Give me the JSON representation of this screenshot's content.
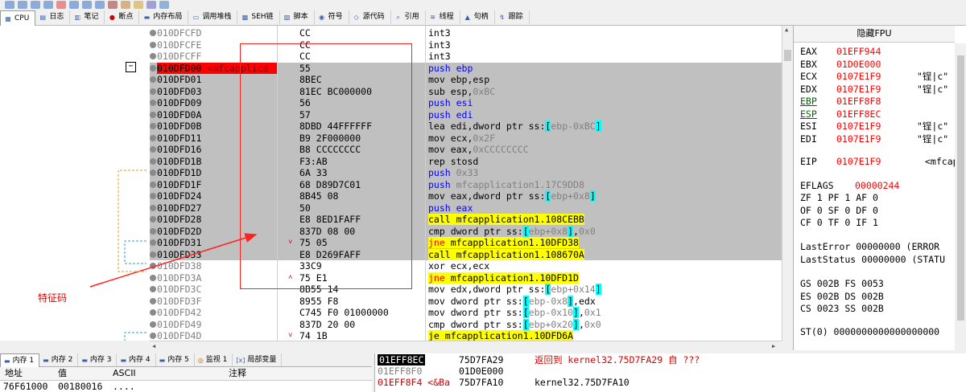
{
  "tabs": [
    {
      "icon": "cpu-icon",
      "label": "CPU"
    },
    {
      "icon": "log-icon",
      "label": "日志"
    },
    {
      "icon": "notes-icon",
      "label": "笔记"
    },
    {
      "icon": "breakpoint-icon",
      "label": "断点"
    },
    {
      "icon": "memory-map-icon",
      "label": "内存布局"
    },
    {
      "icon": "callstack-icon",
      "label": "调用堆栈"
    },
    {
      "icon": "seh-icon",
      "label": "SEH链"
    },
    {
      "icon": "script-icon",
      "label": "脚本"
    },
    {
      "icon": "symbol-icon",
      "label": "符号"
    },
    {
      "icon": "source-icon",
      "label": "源代码"
    },
    {
      "icon": "reference-icon",
      "label": "引用"
    },
    {
      "icon": "thread-icon",
      "label": "线程"
    },
    {
      "icon": "handle-icon",
      "label": "句柄"
    },
    {
      "icon": "trace-icon",
      "label": "跟踪"
    }
  ],
  "disasm": [
    {
      "addr": "010DFCFD",
      "label": "",
      "bytes": "CC",
      "mark": "",
      "hl": false,
      "cur": false,
      "instr": [
        {
          "t": "int3",
          "c": ""
        }
      ]
    },
    {
      "addr": "010DFCFE",
      "label": "",
      "bytes": "CC",
      "mark": "",
      "hl": false,
      "cur": false,
      "instr": [
        {
          "t": "int3",
          "c": ""
        }
      ]
    },
    {
      "addr": "010DFCFF",
      "label": "",
      "bytes": "CC",
      "mark": "",
      "hl": false,
      "cur": false,
      "instr": [
        {
          "t": "int3",
          "c": ""
        }
      ]
    },
    {
      "addr": "010DFD00",
      "label": " <mfcapplica",
      "bytes": "55",
      "mark": "",
      "hl": true,
      "cur": true,
      "instr": [
        {
          "t": "push ebp",
          "c": "k-blue"
        }
      ]
    },
    {
      "addr": "010DFD01",
      "label": "",
      "bytes": "8BEC",
      "mark": "",
      "hl": true,
      "cur": false,
      "instr": [
        {
          "t": "mov ebp,esp",
          "c": ""
        }
      ]
    },
    {
      "addr": "010DFD03",
      "label": "",
      "bytes": "81EC BC000000",
      "mark": "",
      "hl": true,
      "cur": false,
      "instr": [
        {
          "t": "sub esp,",
          "c": ""
        },
        {
          "t": "0xBC",
          "c": "k-gray"
        }
      ]
    },
    {
      "addr": "010DFD09",
      "label": "",
      "bytes": "56",
      "mark": "",
      "hl": true,
      "cur": false,
      "instr": [
        {
          "t": "push esi",
          "c": "k-blue"
        }
      ]
    },
    {
      "addr": "010DFD0A",
      "label": "",
      "bytes": "57",
      "mark": "",
      "hl": true,
      "cur": false,
      "instr": [
        {
          "t": "push edi",
          "c": "k-blue"
        }
      ]
    },
    {
      "addr": "010DFD0B",
      "label": "",
      "bytes": "8DBD 44FFFFFF",
      "mark": "",
      "hl": true,
      "cur": false,
      "instr": [
        {
          "t": "lea edi,dword ptr ss:",
          "c": ""
        },
        {
          "t": "[",
          "c": "cbg"
        },
        {
          "t": "ebp-0xBC",
          "c": "k-gray"
        },
        {
          "t": "]",
          "c": "cbg"
        }
      ]
    },
    {
      "addr": "010DFD11",
      "label": "",
      "bytes": "B9 2F000000",
      "mark": "",
      "hl": true,
      "cur": false,
      "instr": [
        {
          "t": "mov ecx,",
          "c": ""
        },
        {
          "t": "0x2F",
          "c": "k-gray"
        }
      ]
    },
    {
      "addr": "010DFD16",
      "label": "",
      "bytes": "B8 CCCCCCCC",
      "mark": "",
      "hl": true,
      "cur": false,
      "instr": [
        {
          "t": "mov eax,",
          "c": ""
        },
        {
          "t": "0xCCCCCCCC",
          "c": "k-gray"
        }
      ]
    },
    {
      "addr": "010DFD1B",
      "label": "",
      "bytes": "F3:AB",
      "mark": "",
      "hl": true,
      "cur": false,
      "instr": [
        {
          "t": "rep stosd",
          "c": ""
        }
      ]
    },
    {
      "addr": "010DFD1D",
      "label": "",
      "bytes": "6A 33",
      "mark": "",
      "hl": true,
      "cur": false,
      "instr": [
        {
          "t": "push ",
          "c": "k-blue"
        },
        {
          "t": "0x33",
          "c": "k-gray"
        }
      ]
    },
    {
      "addr": "010DFD1F",
      "label": "",
      "bytes": "68 D89D7C01",
      "mark": "",
      "hl": true,
      "cur": false,
      "instr": [
        {
          "t": "push ",
          "c": "k-blue"
        },
        {
          "t": "mfcapplication1.17C9DD8",
          "c": "k-gray"
        }
      ]
    },
    {
      "addr": "010DFD24",
      "label": "",
      "bytes": "8B45 08",
      "mark": "",
      "hl": true,
      "cur": false,
      "instr": [
        {
          "t": "mov eax,dword ptr ss:",
          "c": ""
        },
        {
          "t": "[",
          "c": "cbg"
        },
        {
          "t": "ebp+0x8",
          "c": "k-gray"
        },
        {
          "t": "]",
          "c": "cbg"
        }
      ]
    },
    {
      "addr": "010DFD27",
      "label": "",
      "bytes": "50",
      "mark": "",
      "hl": true,
      "cur": false,
      "instr": [
        {
          "t": "push eax",
          "c": "k-blue"
        }
      ]
    },
    {
      "addr": "010DFD28",
      "label": "",
      "bytes": "E8 8ED1FAFF",
      "mark": "",
      "hl": true,
      "cur": false,
      "instr": [
        {
          "t": "call mfcapplication1.108CEBB",
          "c": "ybg"
        }
      ]
    },
    {
      "addr": "010DFD2D",
      "label": "",
      "bytes": "837D 08 00",
      "mark": "",
      "hl": true,
      "cur": false,
      "instr": [
        {
          "t": "cmp dword ptr ss:",
          "c": ""
        },
        {
          "t": "[",
          "c": "cbg"
        },
        {
          "t": "ebp+0x8",
          "c": "k-gray"
        },
        {
          "t": "]",
          "c": "cbg"
        },
        {
          "t": ",",
          "c": ""
        },
        {
          "t": "0x0",
          "c": "k-gray"
        }
      ]
    },
    {
      "addr": "010DFD31",
      "label": "",
      "bytes": "75 05",
      "mark": "˅",
      "hl": true,
      "cur": false,
      "instr": [
        {
          "t": "jne",
          "c": "ybg k-red"
        },
        {
          "t": " mfcapplication1.10DFD38",
          "c": "ybg"
        }
      ]
    },
    {
      "addr": "010DFD33",
      "label": "",
      "bytes": "E8 D269FAFF",
      "mark": "",
      "hl": true,
      "cur": false,
      "instr": [
        {
          "t": "call mfcapplication1.108670A",
          "c": "ybg"
        }
      ]
    },
    {
      "addr": "010DFD38",
      "label": "",
      "bytes": "33C9",
      "mark": "",
      "hl": false,
      "cur": false,
      "instr": [
        {
          "t": "xor ecx,ecx",
          "c": ""
        }
      ]
    },
    {
      "addr": "010DFD3A",
      "label": "",
      "bytes": "75 E1",
      "mark": "˄",
      "hl": false,
      "cur": false,
      "instr": [
        {
          "t": "jne",
          "c": "ybg k-red"
        },
        {
          "t": " mfcapplication1.10DFD1D",
          "c": "ybg"
        }
      ]
    },
    {
      "addr": "010DFD3C",
      "label": "",
      "bytes": "8B55 14",
      "mark": "",
      "hl": false,
      "cur": false,
      "instr": [
        {
          "t": "mov edx,dword ptr ss:",
          "c": ""
        },
        {
          "t": "[",
          "c": "cbg"
        },
        {
          "t": "ebp+0x14",
          "c": "k-gray"
        },
        {
          "t": "]",
          "c": "cbg"
        }
      ]
    },
    {
      "addr": "010DFD3F",
      "label": "",
      "bytes": "8955 F8",
      "mark": "",
      "hl": false,
      "cur": false,
      "instr": [
        {
          "t": "mov dword ptr ss:",
          "c": ""
        },
        {
          "t": "[",
          "c": "cbg"
        },
        {
          "t": "ebp-0x8",
          "c": "k-gray"
        },
        {
          "t": "]",
          "c": "cbg"
        },
        {
          "t": ",edx",
          "c": ""
        }
      ]
    },
    {
      "addr": "010DFD42",
      "label": "",
      "bytes": "C745 F0 01000000",
      "mark": "",
      "hl": false,
      "cur": false,
      "instr": [
        {
          "t": "mov dword ptr ss:",
          "c": ""
        },
        {
          "t": "[",
          "c": "cbg"
        },
        {
          "t": "ebp-0x10",
          "c": "k-gray"
        },
        {
          "t": "]",
          "c": "cbg"
        },
        {
          "t": ",",
          "c": ""
        },
        {
          "t": "0x1",
          "c": "k-gray"
        }
      ]
    },
    {
      "addr": "010DFD49",
      "label": "",
      "bytes": "837D 20 00",
      "mark": "",
      "hl": false,
      "cur": false,
      "instr": [
        {
          "t": "cmp dword ptr ss:",
          "c": ""
        },
        {
          "t": "[",
          "c": "cbg"
        },
        {
          "t": "ebp+0x20",
          "c": "k-gray"
        },
        {
          "t": "]",
          "c": "cbg"
        },
        {
          "t": ",",
          "c": ""
        },
        {
          "t": "0x0",
          "c": "k-gray"
        }
      ]
    },
    {
      "addr": "010DFD4D",
      "label": "",
      "bytes": "74 1B",
      "mark": "˅",
      "hl": false,
      "cur": false,
      "instr": [
        {
          "t": "je mfcapplication1.10DFD6A",
          "c": "ybg"
        }
      ]
    }
  ],
  "annotation": {
    "label": "特征码",
    "color": "#ff2020"
  },
  "registers": {
    "header": "隐藏FPU",
    "rows": [
      {
        "name": "EAX",
        "value": "01EFF944",
        "comment": "",
        "underline": false
      },
      {
        "name": "EBX",
        "value": "01D0E000",
        "comment": "",
        "underline": false
      },
      {
        "name": "ECX",
        "value": "0107E1F9",
        "comment": "\"锃|c\"",
        "underline": false
      },
      {
        "name": "EDX",
        "value": "0107E1F9",
        "comment": "\"锃|c\"",
        "underline": false
      },
      {
        "name": "EBP",
        "value": "01EFF8F8",
        "comment": "",
        "underline": true
      },
      {
        "name": "ESP",
        "value": "01EFF8EC",
        "comment": "",
        "underline": true
      },
      {
        "name": "ESI",
        "value": "0107E1F9",
        "comment": "\"锃|c\"",
        "underline": false
      },
      {
        "name": "EDI",
        "value": "0107E1F9",
        "comment": "\"锃|c\"",
        "underline": false
      }
    ],
    "eip": {
      "name": "EIP",
      "value": "0107E1F9",
      "comment": "<mfcapp"
    },
    "eflags": {
      "name": "EFLAGS",
      "value": "00000244"
    },
    "flags": [
      "ZF 1  PF 1  AF 0",
      "OF 0  SF 0  DF 0",
      "CF 0  TF 0  IF 1"
    ],
    "last": [
      "LastError  00000000 (ERROR",
      "LastStatus 00000000 (STATU"
    ],
    "segs": [
      "GS 002B  FS 0053",
      "ES 002B  DS 002B",
      "CS 0023  SS 002B"
    ],
    "st0": "ST(0) 0000000000000000000"
  },
  "memory_tabs": [
    {
      "icon": "memory-icon",
      "label": "内存 1"
    },
    {
      "icon": "memory-icon",
      "label": "内存 2"
    },
    {
      "icon": "memory-icon",
      "label": "内存 3"
    },
    {
      "icon": "memory-icon",
      "label": "内存 4"
    },
    {
      "icon": "memory-icon",
      "label": "内存 5"
    },
    {
      "icon": "watch-icon",
      "label": "监视 1"
    },
    {
      "icon": "locals-icon",
      "label": "局部变量"
    }
  ],
  "memory": {
    "headers": [
      "地址",
      "值",
      "ASCII",
      "注释"
    ],
    "row": {
      "addr": "76F61000",
      "value": "00180016",
      "ascii": "...."
    }
  },
  "stack": [
    {
      "addr": "01EFF8EC",
      "value": "75D7FA29",
      "comment": "返回到 kernel32.75D7FA29 自 ???",
      "sel": true
    },
    {
      "addr": "01EFF8F0",
      "value": "01D0E000",
      "comment": "",
      "sel": false
    },
    {
      "addr": "01EFF8F4 <&Ba",
      "value": "75D7FA10",
      "comment": "kernel32.75D7FA10",
      "sel": false
    }
  ]
}
